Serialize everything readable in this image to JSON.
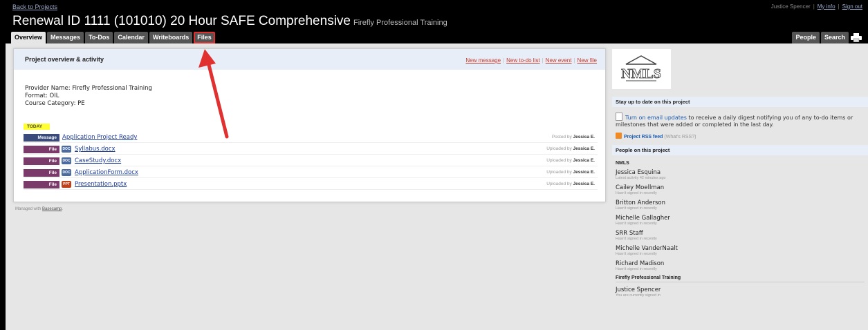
{
  "nav": {
    "back": "Back to Projects"
  },
  "user": {
    "name": "Justice Spencer",
    "my_info": "My info",
    "sign_out": "Sign out"
  },
  "project": {
    "title": "Renewal ID 1111 (101010) 20 Hour SAFE Comprehensive",
    "company": "Firefly Professional Training"
  },
  "tabs": [
    "Overview",
    "Messages",
    "To-Dos",
    "Calendar",
    "Writeboards",
    "Files"
  ],
  "right_tabs": [
    "People",
    "Search"
  ],
  "panel": {
    "title": "Project overview & activity",
    "actions": [
      "New message",
      "New to-do list",
      "New event",
      "New file"
    ],
    "info": [
      "Provider Name: Firefly Professional Training",
      "Format: OIL",
      "Course Category: PE"
    ],
    "today_label": "TODAY"
  },
  "activity": [
    {
      "type": "Message",
      "title": "Application Project Ready",
      "icon": "",
      "verb": "Posted by",
      "who": "Jessica E."
    },
    {
      "type": "File",
      "title": "Syllabus.docx",
      "icon": "DOC",
      "verb": "Uploaded by",
      "who": "Jessica E."
    },
    {
      "type": "File",
      "title": "CaseStudy.docx",
      "icon": "DOC",
      "verb": "Uploaded by",
      "who": "Jessica E."
    },
    {
      "type": "File",
      "title": "ApplicationForm.docx",
      "icon": "DOC",
      "verb": "Uploaded by",
      "who": "Jessica E."
    },
    {
      "type": "File",
      "title": "Presentation.pptx",
      "icon": "PPT",
      "verb": "Uploaded by",
      "who": "Jessica E."
    }
  ],
  "footer": {
    "prefix": "Managed with",
    "link": "Basecamp",
    "suffix": "."
  },
  "sidebar": {
    "logo_text": "NMLS",
    "stay_head": "Stay up to date on this project",
    "email_link": "Turn on email updates",
    "email_text": "to receive a daily digest notifying you of any to-do items or milestones that were added or completed in the last day.",
    "rss_link": "Project RSS feed",
    "rss_help": "(What's RSS?)",
    "people_head": "People on this project",
    "groups": [
      {
        "name": "NMLS",
        "people": [
          {
            "name": "Jessica Esquina",
            "status": "Latest activity 42 minutes ago"
          },
          {
            "name": "Cailey Moellman",
            "status": "Hasn't signed in recently"
          },
          {
            "name": "Britton Anderson",
            "status": "Hasn't signed in recently"
          },
          {
            "name": "Michelle Gallagher",
            "status": "Hasn't signed in recently"
          },
          {
            "name": "SRR Staff",
            "status": "Hasn't signed in recently"
          },
          {
            "name": "Michelle VanderNaalt",
            "status": "Hasn't signed in recently"
          },
          {
            "name": "Richard Madison",
            "status": "Hasn't signed in recently"
          }
        ]
      },
      {
        "name": "Firefly Professional Training",
        "people": [
          {
            "name": "Justice Spencer",
            "status": "You are currently signed in"
          }
        ]
      }
    ]
  },
  "colors": {
    "accent_red": "#e03030",
    "header_bg": "#000000",
    "link_blue": "#1a3a9a"
  }
}
